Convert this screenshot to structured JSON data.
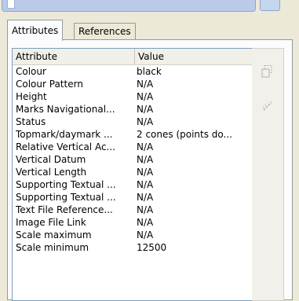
{
  "tabs": [
    {
      "label": "Attributes",
      "active": true
    },
    {
      "label": "References",
      "active": false
    }
  ],
  "table": {
    "columns": [
      "Attribute",
      "Value"
    ],
    "rows": [
      {
        "attribute": "Colour",
        "value": "black"
      },
      {
        "attribute": "Colour Pattern",
        "value": "N/A"
      },
      {
        "attribute": "Height",
        "value": "N/A"
      },
      {
        "attribute": "Marks Navigational...",
        "value": "N/A"
      },
      {
        "attribute": "Status",
        "value": "N/A"
      },
      {
        "attribute": "Topmark/daymark ...",
        "value": "2 cones (points do..."
      },
      {
        "attribute": "Relative Vertical Ac...",
        "value": "N/A"
      },
      {
        "attribute": "Vertical Datum",
        "value": "N/A"
      },
      {
        "attribute": "Vertical Length",
        "value": "N/A"
      },
      {
        "attribute": "Supporting Textual ...",
        "value": "N/A"
      },
      {
        "attribute": "Supporting Textual ...",
        "value": "N/A"
      },
      {
        "attribute": "Text File Reference...",
        "value": "N/A"
      },
      {
        "attribute": "Image File Link",
        "value": "N/A"
      },
      {
        "attribute": "Scale maximum",
        "value": "N/A"
      },
      {
        "attribute": "Scale minimum",
        "value": "12500"
      }
    ]
  },
  "toolbar": {
    "buttons": [
      {
        "icon": "copy-icon",
        "enabled": false
      },
      {
        "icon": "edit-icon",
        "enabled": false
      }
    ]
  }
}
